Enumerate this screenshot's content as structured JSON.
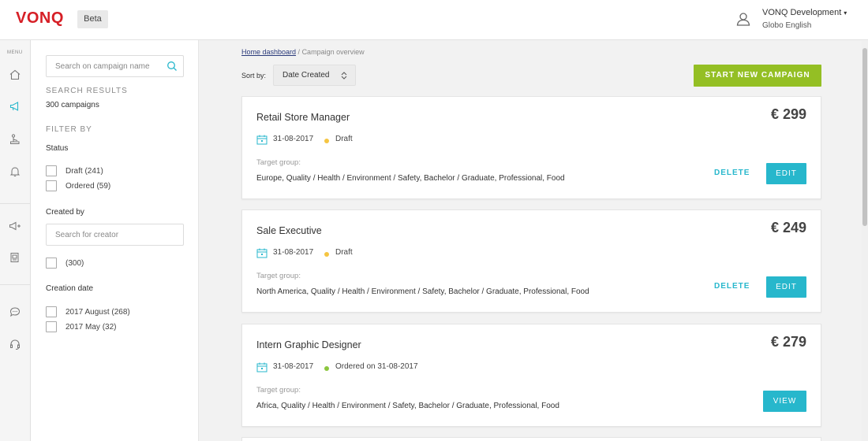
{
  "header": {
    "logo": "VONQ",
    "badge": "Beta",
    "user_name": "VONQ Development",
    "user_caret": "▾",
    "user_org": "Globo English"
  },
  "rail": {
    "menu_label": "MENU",
    "icons": [
      "home-icon",
      "megaphone-icon",
      "joystick-icon",
      "bell-icon",
      "megaphone-add-icon",
      "document-image-icon",
      "chat-icon",
      "headset-icon"
    ],
    "active_color": "#27b7cc"
  },
  "filters": {
    "search_placeholder": "Search on campaign name",
    "results_label": "SEARCH RESULTS",
    "results_count": "300 campaigns",
    "filter_by_label": "FILTER BY",
    "status": {
      "label": "Status",
      "options": [
        {
          "label": "Draft (241)",
          "checked": false
        },
        {
          "label": "Ordered (59)",
          "checked": false
        }
      ]
    },
    "created_by": {
      "label": "Created by",
      "placeholder": "Search for creator",
      "options": [
        {
          "label": "(300)",
          "checked": false
        }
      ]
    },
    "creation_date": {
      "label": "Creation date",
      "options": [
        {
          "label": "2017 August (268)",
          "checked": false
        },
        {
          "label": "2017 May (32)",
          "checked": false
        }
      ]
    }
  },
  "main": {
    "breadcrumb": {
      "link": "Home dashboard",
      "separator": " / ",
      "current": "Campaign overview"
    },
    "sort": {
      "label": "Sort by:",
      "value": "Date Created",
      "arrow": "⌃⌄"
    },
    "start_button": "START NEW CAMPAIGN",
    "colors": {
      "accent": "#27b7cc",
      "primary_green": "#94bf24",
      "draft_dot": "#f5c542",
      "ordered_dot": "#8cc63f"
    },
    "campaigns": [
      {
        "title": "Retail Store Manager",
        "price": "€ 299",
        "date": "31-08-2017",
        "status": "Draft",
        "status_color": "#f5c542",
        "target_label": "Target group:",
        "target_value": "Europe, Quality / Health / Environment / Safety, Bachelor / Graduate, Professional, Food",
        "delete_label": "DELETE",
        "action_label": "EDIT"
      },
      {
        "title": "Sale Executive",
        "price": "€ 249",
        "date": "31-08-2017",
        "status": "Draft",
        "status_color": "#f5c542",
        "target_label": "Target group:",
        "target_value": "North America, Quality / Health / Environment / Safety, Bachelor / Graduate, Professional, Food",
        "delete_label": "DELETE",
        "action_label": "EDIT"
      },
      {
        "title": "Intern Graphic Designer",
        "price": "€ 279",
        "date": "31-08-2017",
        "status": "Ordered on 31-08-2017",
        "status_color": "#8cc63f",
        "target_label": "Target group:",
        "target_value": "Africa, Quality / Health / Environment / Safety, Bachelor / Graduate, Professional, Food",
        "delete_label": "",
        "action_label": "VIEW"
      }
    ]
  }
}
